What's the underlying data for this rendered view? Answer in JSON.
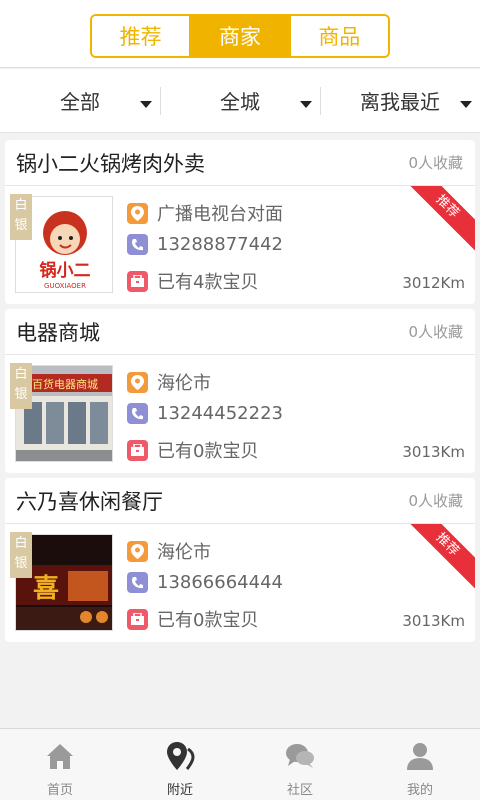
{
  "tabs": [
    {
      "label": "推荐",
      "active": false
    },
    {
      "label": "商家",
      "active": true
    },
    {
      "label": "商品",
      "active": false
    }
  ],
  "filters": [
    {
      "label": "全部"
    },
    {
      "label": "全城"
    },
    {
      "label": "离我最近"
    }
  ],
  "shops": [
    {
      "name": "锅小二火锅烤肉外卖",
      "favorites": "0人收藏",
      "tier": "白银",
      "recommended": true,
      "recommend_label": "推荐",
      "address": "广播电视台对面",
      "phone": "13288877442",
      "products": "已有4款宝贝",
      "distance": "3012Km",
      "logo_text": "锅小二",
      "logo_subtext": "GUOXIAOER"
    },
    {
      "name": "电器商城",
      "favorites": "0人收藏",
      "tier": "白银",
      "recommended": false,
      "address": "海伦市",
      "phone": "13244452223",
      "products": "已有0款宝贝",
      "distance": "3013Km",
      "sign_text": "百货电器商城"
    },
    {
      "name": "六乃喜休闲餐厅",
      "favorites": "0人收藏",
      "tier": "白银",
      "recommended": true,
      "recommend_label": "推荐",
      "address": "海伦市",
      "phone": "13866664444",
      "products": "已有0款宝贝",
      "distance": "3013Km",
      "sign_text": "喜"
    }
  ],
  "nav": [
    {
      "label": "首页",
      "icon": "home-icon",
      "active": false
    },
    {
      "label": "附近",
      "icon": "nearby-pin-icon",
      "active": true
    },
    {
      "label": "社区",
      "icon": "community-chat-icon",
      "active": false
    },
    {
      "label": "我的",
      "icon": "profile-icon",
      "active": false
    }
  ],
  "colors": {
    "accent": "#f0b400",
    "ribbon": "#e8303b",
    "location_icon": "#f39a3c",
    "phone_icon": "#8f8fd6",
    "bag_icon": "#ee5a6a"
  }
}
